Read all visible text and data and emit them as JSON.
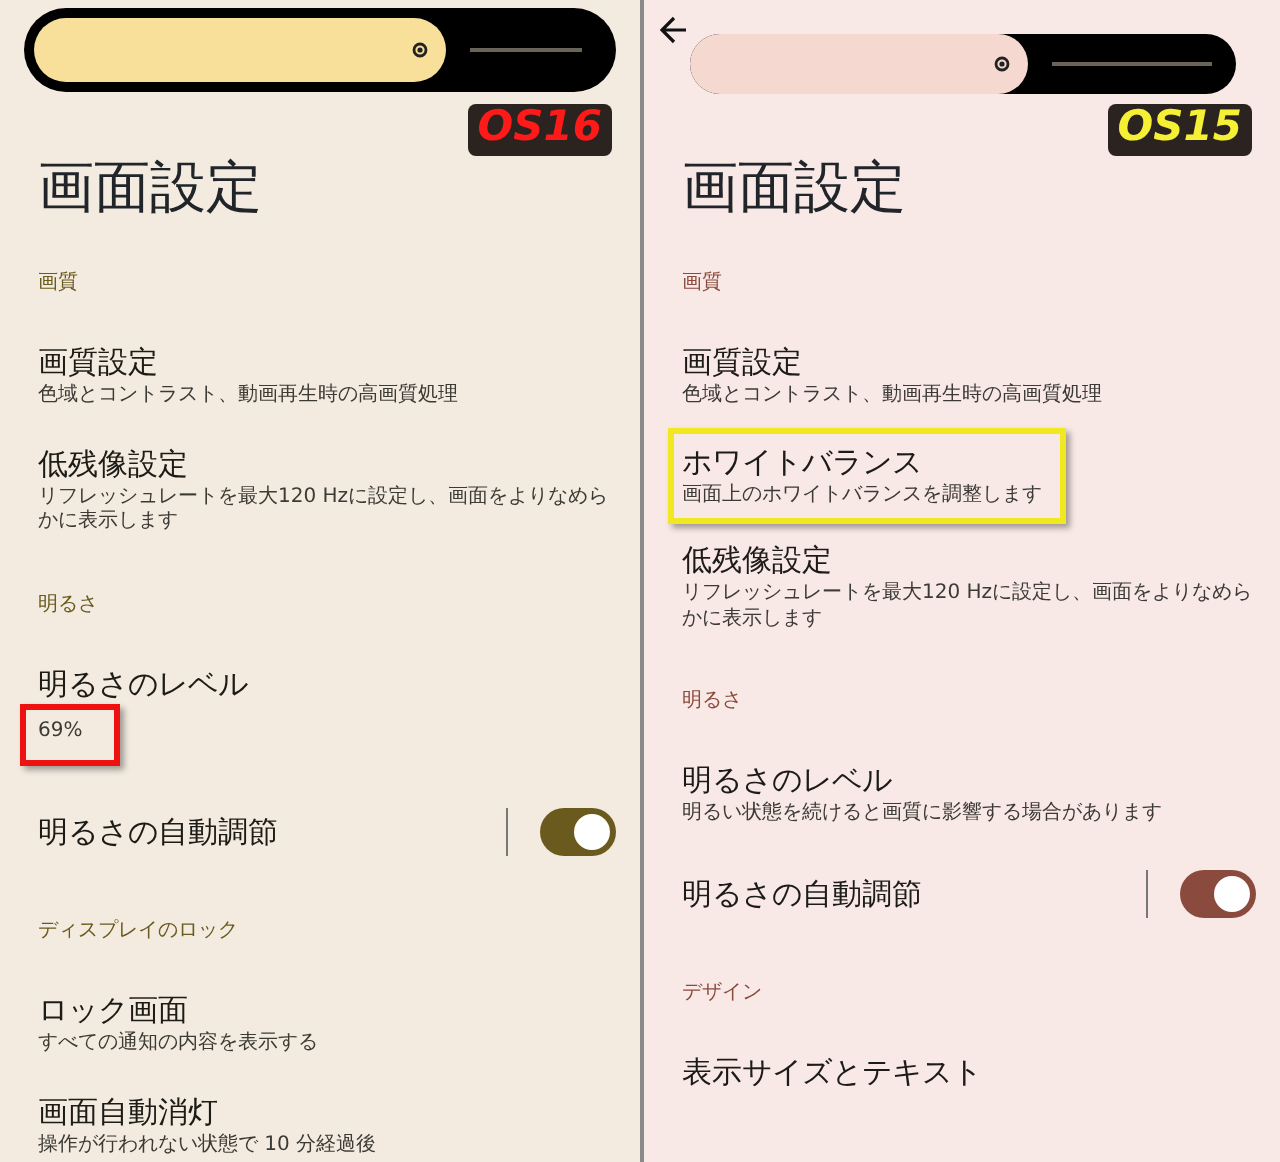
{
  "panels": [
    {
      "slider": {
        "level": 0.72
      },
      "badge": {
        "label": "OS16",
        "color": "#ff1a1a"
      },
      "title": "画面設定",
      "color": "#f3ebe0",
      "items": [
        {
          "kind": "header",
          "label": "画質",
          "color": "#6b5a1e"
        },
        {
          "kind": "item",
          "title": "画質設定",
          "subtitle": "色域とコントラスト、動画再生時の高画質処理"
        },
        {
          "kind": "item",
          "title": "低残像設定",
          "subtitle": "リフレッシュレートを最大120 Hzに設定し、画面をよりなめらかに表示します"
        },
        {
          "kind": "header",
          "label": "明るさ",
          "color": "#6b5a1e"
        },
        {
          "kind": "item",
          "title": "明るさのレベル",
          "subtitle": "69%",
          "subtitle_highlight": {
            "color": "#ee1111"
          }
        },
        {
          "kind": "toggle",
          "title": "明るさの自動調節",
          "on": true,
          "color": "#6b5a1e"
        },
        {
          "kind": "header",
          "label": "ディスプレイのロック",
          "color": "#6b5a1e"
        },
        {
          "kind": "item",
          "title": "ロック画面",
          "subtitle": "すべての通知の内容を表示する"
        },
        {
          "kind": "item",
          "title": "画面自動消灯",
          "subtitle": "操作が行われない状態で 10 分経過後"
        }
      ]
    },
    {
      "back": true,
      "slider": {
        "level": 0.62
      },
      "badge": {
        "label": "OS15",
        "color": "#f5f035"
      },
      "title": "画面設定",
      "color": "#f8e9e6",
      "items": [
        {
          "kind": "header",
          "label": "画質",
          "color": "#8b4a3e"
        },
        {
          "kind": "item",
          "title": "画質設定",
          "subtitle": "色域とコントラスト、動画再生時の高画質処理"
        },
        {
          "kind": "item",
          "title": "ホワイトバランス",
          "subtitle": "画面上のホワイトバランスを調整します",
          "highlight": {
            "color": "#f0e820"
          }
        },
        {
          "kind": "item",
          "title": "低残像設定",
          "subtitle": "リフレッシュレートを最大120 Hzに設定し、画面をよりなめらかに表示します"
        },
        {
          "kind": "header",
          "label": "明るさ",
          "color": "#8b4a3e"
        },
        {
          "kind": "item",
          "title": "明るさのレベル",
          "subtitle": "明るい状態を続けると画質に影響する場合があります"
        },
        {
          "kind": "toggle",
          "title": "明るさの自動調節",
          "on": true,
          "color": "#8b4a3e"
        },
        {
          "kind": "header",
          "label": "デザイン",
          "color": "#8b4a3e"
        },
        {
          "kind": "item",
          "title": "表示サイズとテキスト"
        }
      ]
    }
  ]
}
